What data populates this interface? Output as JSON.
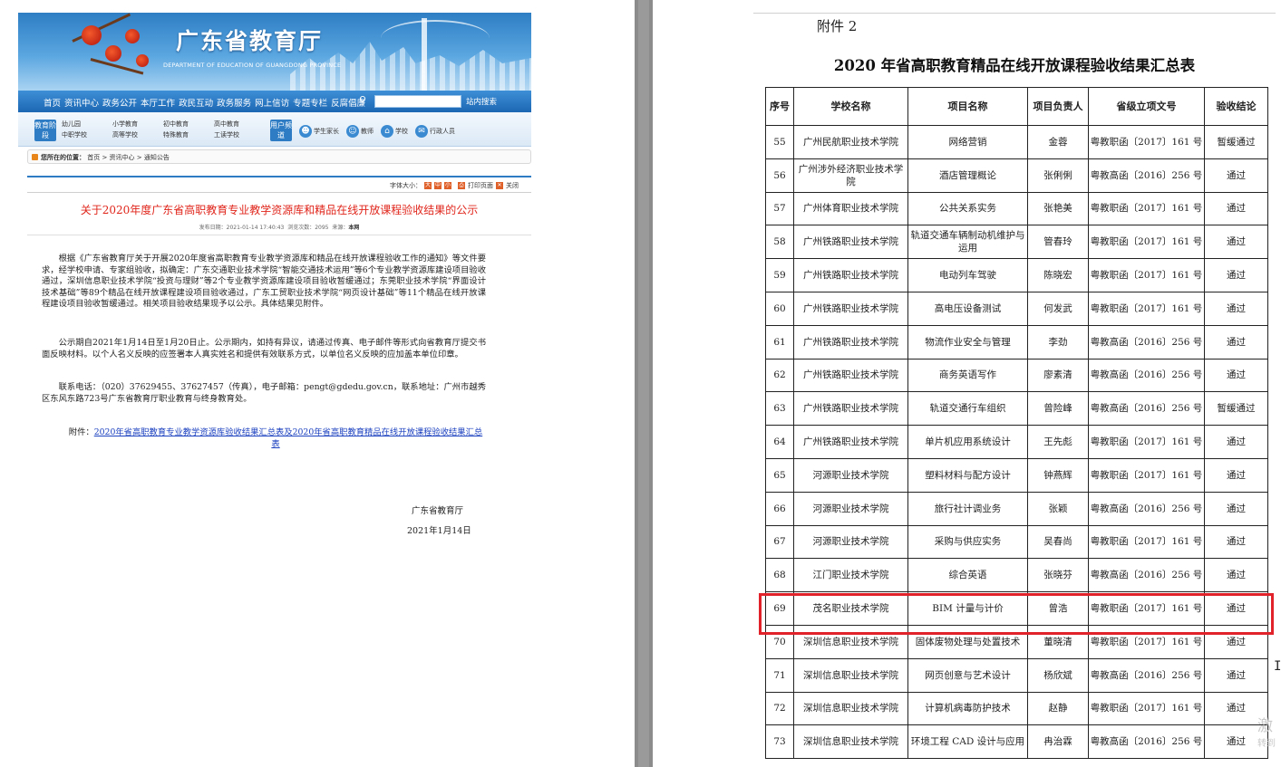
{
  "left_page": {
    "site": {
      "title": "广东省教育厅",
      "subtitle": "DEPARTMENT OF EDUCATION OF GUANGDONG PROVINCE"
    },
    "nav": {
      "items": [
        "首页",
        "资讯中心",
        "政务公开",
        "本厅工作",
        "政民互动",
        "政务服务",
        "网上信访",
        "专题专栏",
        "反腐倡廉"
      ],
      "search_placeholder": "",
      "search_button": "站内搜索"
    },
    "subnav": {
      "stage_tag": "教育阶段",
      "levels": [
        "幼儿园",
        "中职学校",
        "小学教育",
        "高等学校",
        "初中教育",
        "特殊教育",
        "高中教育",
        "工读学校"
      ],
      "user_tag": "用户频道",
      "roles": [
        "学生家长",
        "教师",
        "学校",
        "行政人员"
      ]
    },
    "location": {
      "label": "您所在的位置：",
      "path": "首页 > 资讯中心 > 通知公告"
    },
    "toolbar": {
      "font_size_label": "字体大小：",
      "sizes": [
        "大",
        "中",
        "小"
      ],
      "print": "打印页面",
      "close": "关闭"
    },
    "article": {
      "title": "关于2020年度广东省高职教育专业教学资源库和精品在线开放课程验收结果的公示",
      "meta_date": "发布日期：2021-01-14 17:40:43",
      "meta_views": "浏览次数：2095",
      "meta_source_label": "来源：",
      "meta_source": "本网",
      "paragraphs": [
        "根据《广东省教育厅关于开展2020年度省高职教育专业教学资源库和精品在线开放课程验收工作的通知》等文件要求，经学校申请、专家组验收，拟确定：广东交通职业技术学院“智能交通技术运用”等6个专业教学资源库建设项目验收通过，深圳信息职业技术学院“投资与理财”等2个专业教学资源库建设项目验收暂缓通过；东莞职业技术学院“界面设计技术基础”等89个精品在线开放课程建设项目验收通过，广东工贸职业技术学院“网页设计基础”等11个精品在线开放课程建设项目验收暂缓通过。相关项目验收结果现予以公示。具体结果见附件。",
        "公示期自2021年1月14日至1月20日止。公示期内，如持有异议，请通过传真、电子邮件等形式向省教育厅提交书面反映材料。以个人名义反映的应签署本人真实姓名和提供有效联系方式，以单位名义反映的应加盖本单位印章。",
        "联系电话：（020）37629455、37627457（传真），电子邮箱：pengt@gdedu.gov.cn，联系地址：广州市越秀区东风东路723号广东省教育厅职业教育与终身教育处。"
      ],
      "attachment_label": "附件：",
      "attachment_link": "2020年省高职教育专业教学资源库验收结果汇总表及2020年省高职教育精品在线开放课程验收结果汇总表",
      "sign_org": "广东省教育厅",
      "sign_date": "2021年1月14日"
    }
  },
  "right_page": {
    "attachment_label": "附件 2",
    "title": "2020 年省高职教育精品在线开放课程验收结果汇总表",
    "columns": [
      "序号",
      "学校名称",
      "项目名称",
      "项目负责人",
      "省级立项文号",
      "验收结论"
    ],
    "rows": [
      [
        "55",
        "广州民航职业技术学院",
        "网络营销",
        "金蓉",
        "粤教职函〔2017〕161 号",
        "暂缓通过"
      ],
      [
        "56",
        "广州涉外经济职业技术学院",
        "酒店管理概论",
        "张俐俐",
        "粤教高函〔2016〕256 号",
        "通过"
      ],
      [
        "57",
        "广州体育职业技术学院",
        "公共关系实务",
        "张艳美",
        "粤教职函〔2017〕161 号",
        "通过"
      ],
      [
        "58",
        "广州铁路职业技术学院",
        "轨道交通车辆制动机维护与运用",
        "管春玲",
        "粤教职函〔2017〕161 号",
        "通过"
      ],
      [
        "59",
        "广州铁路职业技术学院",
        "电动列车驾驶",
        "陈晓宏",
        "粤教职函〔2017〕161 号",
        "通过"
      ],
      [
        "60",
        "广州铁路职业技术学院",
        "高电压设备测试",
        "何发武",
        "粤教职函〔2017〕161 号",
        "通过"
      ],
      [
        "61",
        "广州铁路职业技术学院",
        "物流作业安全与管理",
        "李劲",
        "粤教高函〔2016〕256 号",
        "通过"
      ],
      [
        "62",
        "广州铁路职业技术学院",
        "商务英语写作",
        "廖素清",
        "粤教高函〔2016〕256 号",
        "通过"
      ],
      [
        "63",
        "广州铁路职业技术学院",
        "轨道交通行车组织",
        "曾险峰",
        "粤教高函〔2016〕256 号",
        "暂缓通过"
      ],
      [
        "64",
        "广州铁路职业技术学院",
        "单片机应用系统设计",
        "王先彪",
        "粤教职函〔2017〕161 号",
        "通过"
      ],
      [
        "65",
        "河源职业技术学院",
        "塑料材料与配方设计",
        "钟燕辉",
        "粤教职函〔2017〕161 号",
        "通过"
      ],
      [
        "66",
        "河源职业技术学院",
        "旅行社计调业务",
        "张颖",
        "粤教高函〔2016〕256 号",
        "通过"
      ],
      [
        "67",
        "河源职业技术学院",
        "采购与供应实务",
        "吴春尚",
        "粤教职函〔2017〕161 号",
        "通过"
      ],
      [
        "68",
        "江门职业技术学院",
        "综合英语",
        "张晓芬",
        "粤教高函〔2016〕256 号",
        "通过"
      ],
      [
        "69",
        "茂名职业技术学院",
        "BIM 计量与计价",
        "曾浩",
        "粤教职函〔2017〕161 号",
        "通过"
      ],
      [
        "70",
        "深圳信息职业技术学院",
        "固体废物处理与处置技术",
        "董晓清",
        "粤教职函〔2017〕161 号",
        "通过"
      ],
      [
        "71",
        "深圳信息职业技术学院",
        "网页创意与艺术设计",
        "杨欣斌",
        "粤教高函〔2016〕256 号",
        "通过"
      ],
      [
        "72",
        "深圳信息职业技术学院",
        "计算机病毒防护技术",
        "赵静",
        "粤教职函〔2017〕161 号",
        "通过"
      ],
      [
        "73",
        "深圳信息职业技术学院",
        "环境工程 CAD 设计与应用",
        "冉治霖",
        "粤教高函〔2016〕256 号",
        "通过"
      ]
    ],
    "highlighted_row": "69"
  },
  "watermark": {
    "line1": "激",
    "line2": "转到"
  },
  "colors": {
    "accent_blue": "#2d7cc4",
    "title_red": "#e0251b",
    "highlight_red": "#e2222a",
    "link_blue": "#1a3fbf"
  }
}
